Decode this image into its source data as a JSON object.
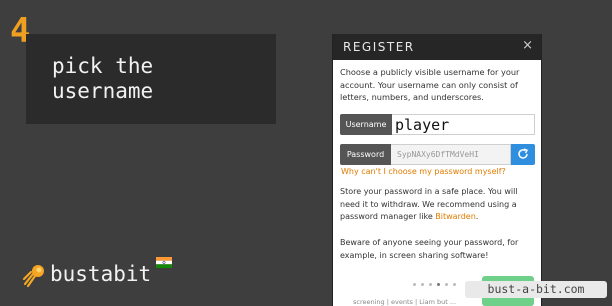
{
  "step": {
    "number": "4",
    "caption": "pick the\nusername"
  },
  "brand": {
    "name": "bustabit",
    "logo_icon": "rocket-icon",
    "flag_icon": "india-flag-icon"
  },
  "modal": {
    "title": "REGISTER",
    "close_label": "×",
    "intro": "Choose a publicly visible username for your account. Your username can only consist of letters, numbers, and underscores.",
    "username_label": "Username",
    "username_value": "player",
    "password_label": "Password",
    "password_value": "SypNAXy6DfTMdVeHI",
    "refresh_icon": "refresh-icon",
    "why_link": "Why can't I choose my password myself?",
    "store_text": "Store your password in a safe place. You will need it to withdraw. We recommend using a password manager like ",
    "bitwarden_link": "Bitwarden",
    "store_text_end": ".",
    "beware_text": "Beware of anyone seeing your password, for example, in screen sharing software!",
    "bottom_text": "screening  | events | Liam but ..."
  },
  "watermark": "bust-a-bit.com",
  "colors": {
    "accent": "#f0a020",
    "link": "#e07b00",
    "button_blue": "#2f8fde",
    "button_green": "#6fd089",
    "header_dark": "#262626"
  }
}
